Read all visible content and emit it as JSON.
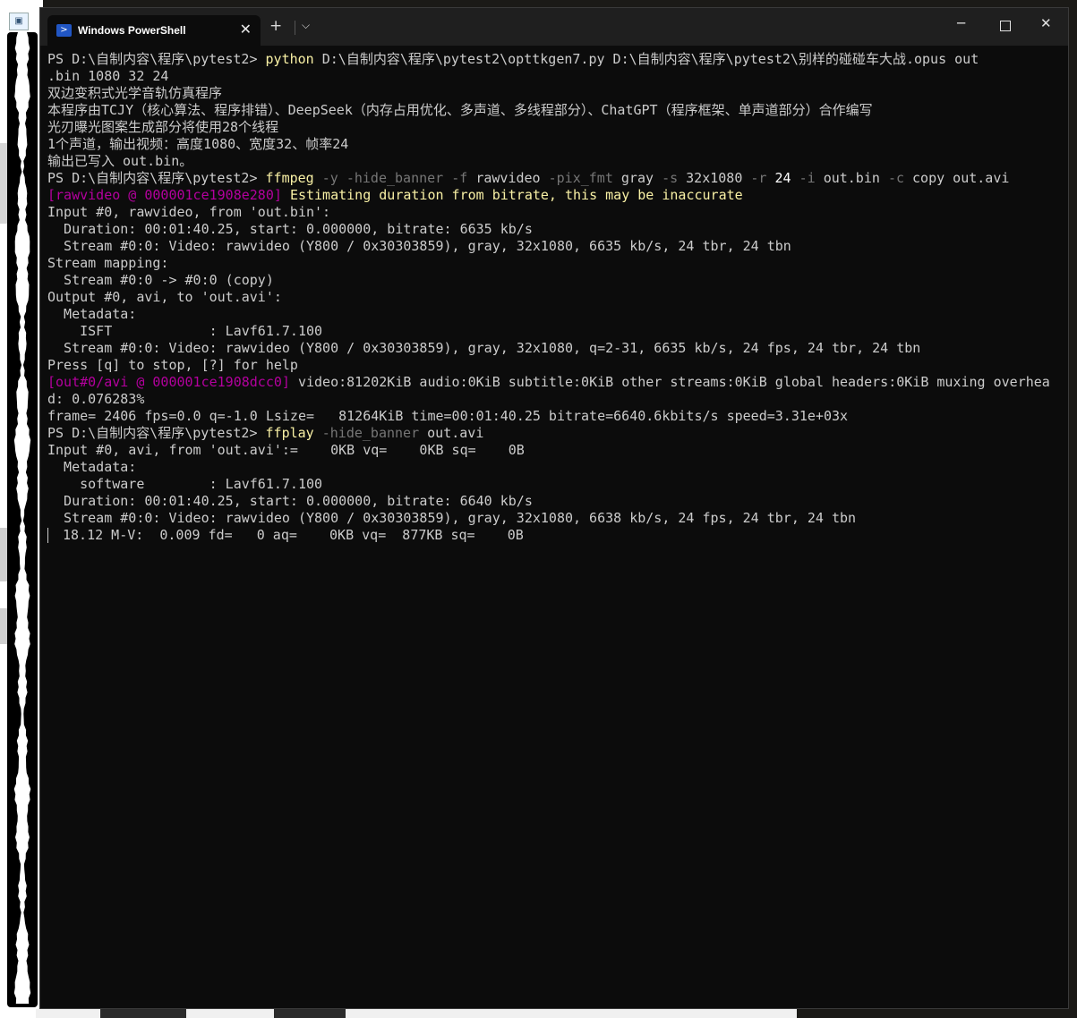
{
  "window": {
    "tab_title": "Windows PowerShell",
    "tab_close": "✕",
    "new_tab": "+",
    "dropdown": "⌵",
    "minimize": "─",
    "close": "✕"
  },
  "colors": {
    "background": "#0c0c0c",
    "text": "#cccccc",
    "command": "#f9f1a5",
    "param": "#767676",
    "magenta": "#b4009e"
  },
  "terminal": {
    "lines": [
      [
        {
          "t": "PS D:\\自制内容\\程序\\pytest2> ",
          "c": ""
        },
        {
          "t": "python",
          "c": "y"
        },
        {
          "t": " D:\\自制内容\\程序\\pytest2\\opttkgen7.py D:\\自制内容\\程序\\pytest2\\别样的碰碰车大战.opus out",
          "c": ""
        }
      ],
      [
        {
          "t": ".bin 1080 32 24",
          "c": ""
        }
      ],
      [
        {
          "t": "双边变积式光学音轨仿真程序",
          "c": ""
        }
      ],
      [
        {
          "t": "本程序由TCJY（核心算法、程序排错）、DeepSeek（内存占用优化、多声道、多线程部分）、ChatGPT（程序框架、单声道部分）合作编写",
          "c": ""
        }
      ],
      [
        {
          "t": "光刃曝光图案生成部分将使用28个线程",
          "c": ""
        }
      ],
      [
        {
          "t": "1个声道，输出视频：高度1080、宽度32、帧率24",
          "c": ""
        }
      ],
      [
        {
          "t": "输出已写入 out.bin。",
          "c": ""
        }
      ],
      [
        {
          "t": "PS D:\\自制内容\\程序\\pytest2> ",
          "c": ""
        },
        {
          "t": "ffmpeg",
          "c": "y"
        },
        {
          "t": " -y -hide_banner -f ",
          "c": "g"
        },
        {
          "t": "rawvideo ",
          "c": ""
        },
        {
          "t": "-pix_fmt ",
          "c": "g"
        },
        {
          "t": "gray ",
          "c": ""
        },
        {
          "t": "-s ",
          "c": "g"
        },
        {
          "t": "32x1080 ",
          "c": ""
        },
        {
          "t": "-r ",
          "c": "g"
        },
        {
          "t": "24 ",
          "c": "w"
        },
        {
          "t": "-i ",
          "c": "g"
        },
        {
          "t": "out.bin ",
          "c": ""
        },
        {
          "t": "-c ",
          "c": "g"
        },
        {
          "t": "copy out.avi",
          "c": ""
        }
      ],
      [
        {
          "t": "[rawvideo @ 000001ce1908e280] ",
          "c": "m"
        },
        {
          "t": "Estimating duration from bitrate, this may be inaccurate",
          "c": "y"
        }
      ],
      [
        {
          "t": "Input #0, rawvideo, from 'out.bin':",
          "c": ""
        }
      ],
      [
        {
          "t": "  Duration: 00:01:40.25, start: 0.000000, bitrate: 6635 kb/s",
          "c": ""
        }
      ],
      [
        {
          "t": "  Stream #0:0: Video: rawvideo (Y800 / 0x30303859), gray, 32x1080, 6635 kb/s, 24 tbr, 24 tbn",
          "c": ""
        }
      ],
      [
        {
          "t": "Stream mapping:",
          "c": ""
        }
      ],
      [
        {
          "t": "  Stream #0:0 -> #0:0 (copy)",
          "c": ""
        }
      ],
      [
        {
          "t": "Output #0, avi, to 'out.avi':",
          "c": ""
        }
      ],
      [
        {
          "t": "  Metadata:",
          "c": ""
        }
      ],
      [
        {
          "t": "    ISFT            : Lavf61.7.100",
          "c": ""
        }
      ],
      [
        {
          "t": "  Stream #0:0: Video: rawvideo (Y800 / 0x30303859), gray, 32x1080, q=2-31, 6635 kb/s, 24 fps, 24 tbr, 24 tbn",
          "c": ""
        }
      ],
      [
        {
          "t": "Press [q] to stop, [?] for help",
          "c": ""
        }
      ],
      [
        {
          "t": "[out#0/avi @ 000001ce1908dcc0] ",
          "c": "m"
        },
        {
          "t": "video:81202KiB audio:0KiB subtitle:0KiB other streams:0KiB global headers:0KiB muxing overhea",
          "c": ""
        }
      ],
      [
        {
          "t": "d: 0.076283%",
          "c": ""
        }
      ],
      [
        {
          "t": "frame= 2406 fps=0.0 q=-1.0 Lsize=   81264KiB time=00:01:40.25 bitrate=6640.6kbits/s speed=3.31e+03x",
          "c": ""
        }
      ],
      [
        {
          "t": "PS D:\\自制内容\\程序\\pytest2> ",
          "c": ""
        },
        {
          "t": "ffplay",
          "c": "y"
        },
        {
          "t": " -hide_banner ",
          "c": "g"
        },
        {
          "t": "out.avi",
          "c": ""
        }
      ],
      [
        {
          "t": "Input #0, avi, from 'out.avi':=    0KB vq=    0KB sq=    0B",
          "c": ""
        }
      ],
      [
        {
          "t": "  Metadata:",
          "c": ""
        }
      ],
      [
        {
          "t": "    software        : Lavf61.7.100",
          "c": ""
        }
      ],
      [
        {
          "t": "  Duration: 00:01:40.25, start: 0.000000, bitrate: 6640 kb/s",
          "c": ""
        }
      ],
      [
        {
          "t": "  Stream #0:0: Video: rawvideo (Y800 / 0x30303859), gray, 32x1080, 6638 kb/s, 24 fps, 24 tbr, 24 tbn",
          "c": ""
        }
      ],
      [
        {
          "t": "18.12 M-V:  0.009 fd=   0 aq=    0KB vq=  877KB sq=    0B",
          "c": "",
          "cursor": true
        }
      ]
    ]
  }
}
